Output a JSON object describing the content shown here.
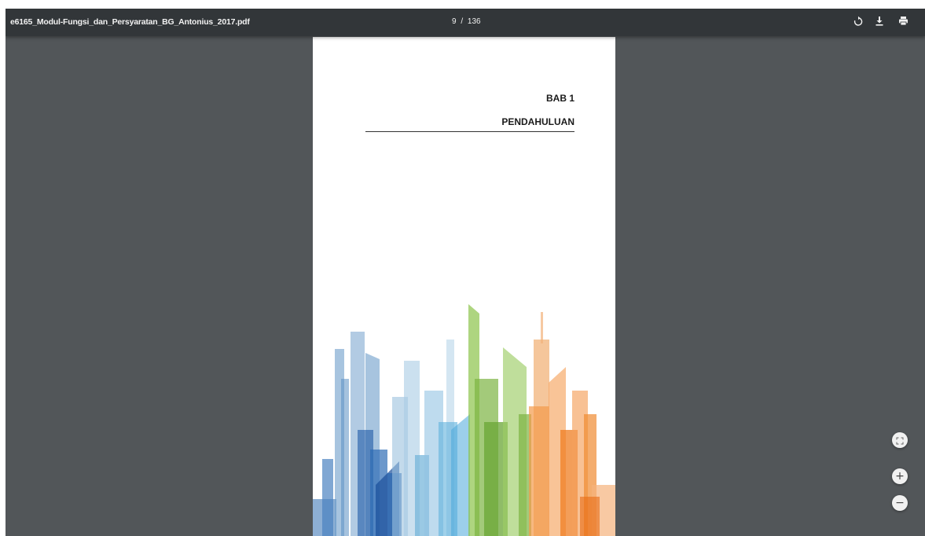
{
  "toolbar": {
    "filename": "e6165_Modul-Fungsi_dan_Persyaratan_BG_Antonius_2017.pdf",
    "current_page": "9",
    "separator": "/",
    "total_pages": "136",
    "icons": [
      "rotate-icon",
      "download-icon",
      "print-icon"
    ]
  },
  "page": {
    "chapter": "BAB 1",
    "chapter_title": "PENDAHULUAN"
  },
  "zoom_controls": {
    "fit_icon": "fit-to-page-icon",
    "zoom_in_label": "+",
    "zoom_out_label": "−"
  },
  "colors": {
    "toolbar_bg": "#323639",
    "viewer_bg": "#525659",
    "blue": "#2f6db0",
    "light_blue": "#7fb3d5",
    "green": "#7cb342",
    "orange": "#ef7d22"
  }
}
